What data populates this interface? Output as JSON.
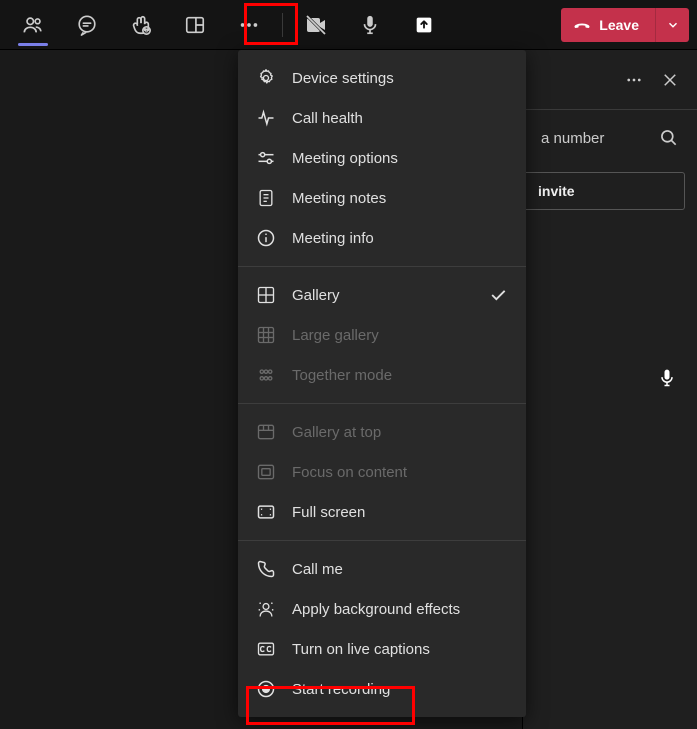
{
  "toolbar": {
    "leave_label": "Leave"
  },
  "panel": {
    "number_hint": "a number",
    "invite_label": "invite"
  },
  "menu": {
    "sections": [
      {
        "items": [
          {
            "icon": "gear",
            "label": "Device settings",
            "disabled": false
          },
          {
            "icon": "pulse",
            "label": "Call health",
            "disabled": false
          },
          {
            "icon": "sliders",
            "label": "Meeting options",
            "disabled": false
          },
          {
            "icon": "notes",
            "label": "Meeting notes",
            "disabled": false
          },
          {
            "icon": "info",
            "label": "Meeting info",
            "disabled": false
          }
        ]
      },
      {
        "items": [
          {
            "icon": "grid2",
            "label": "Gallery",
            "disabled": false,
            "checked": true
          },
          {
            "icon": "grid3",
            "label": "Large gallery",
            "disabled": true
          },
          {
            "icon": "people-group",
            "label": "Together mode",
            "disabled": true
          }
        ]
      },
      {
        "items": [
          {
            "icon": "gallery-top",
            "label": "Gallery at top",
            "disabled": true
          },
          {
            "icon": "focus",
            "label": "Focus on content",
            "disabled": true
          },
          {
            "icon": "fullscreen",
            "label": "Full screen",
            "disabled": false
          }
        ]
      },
      {
        "items": [
          {
            "icon": "phone",
            "label": "Call me",
            "disabled": false
          },
          {
            "icon": "person-bg",
            "label": "Apply background effects",
            "disabled": false
          },
          {
            "icon": "cc",
            "label": "Turn on live captions",
            "disabled": false
          },
          {
            "icon": "record",
            "label": "Start recording",
            "disabled": false
          }
        ]
      }
    ]
  }
}
